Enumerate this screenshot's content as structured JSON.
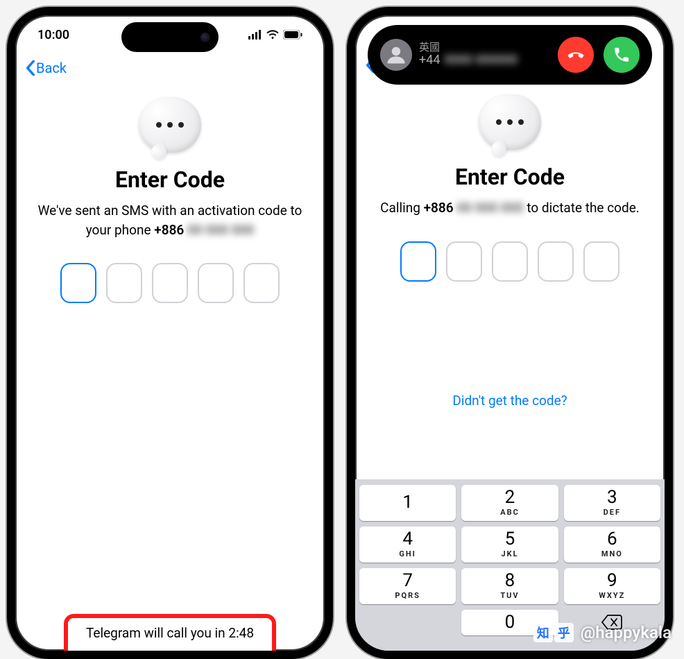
{
  "left": {
    "status_time": "10:00",
    "back_label": "Back",
    "title": "Enter Code",
    "subtitle_pre": "We've sent an SMS with an activation code to your phone ",
    "phone_prefix": "+886",
    "phone_blur": "00 000 000",
    "code_boxes": 5,
    "active_index": 0,
    "call_countdown_pre": "Telegram will call you in ",
    "call_countdown_time": "2:48"
  },
  "right": {
    "call_country": "英國",
    "call_prefix": "+44",
    "call_hidden": "0000 000000",
    "title": "Enter Code",
    "subtitle_pre": "Calling ",
    "phone_prefix": "+886",
    "phone_blur": "00 000 000",
    "subtitle_post": " to dictate the code.",
    "code_boxes": 5,
    "active_index": 0,
    "link_label": "Didn't get the code?",
    "keypad": [
      [
        {
          "n": "1",
          "l": ""
        },
        {
          "n": "2",
          "l": "ABC"
        },
        {
          "n": "3",
          "l": "DEF"
        }
      ],
      [
        {
          "n": "4",
          "l": "GHI"
        },
        {
          "n": "5",
          "l": "JKL"
        },
        {
          "n": "6",
          "l": "MNO"
        }
      ],
      [
        {
          "n": "7",
          "l": "PQRS"
        },
        {
          "n": "8",
          "l": "TUV"
        },
        {
          "n": "9",
          "l": "WXYZ"
        }
      ]
    ],
    "key_zero": "0"
  },
  "watermark": {
    "brand1": "知",
    "brand2": "乎",
    "handle": "@happykala"
  },
  "colors": {
    "ios_blue": "#007aff",
    "decline_red": "#ff3b30",
    "accept_green": "#34c759"
  }
}
